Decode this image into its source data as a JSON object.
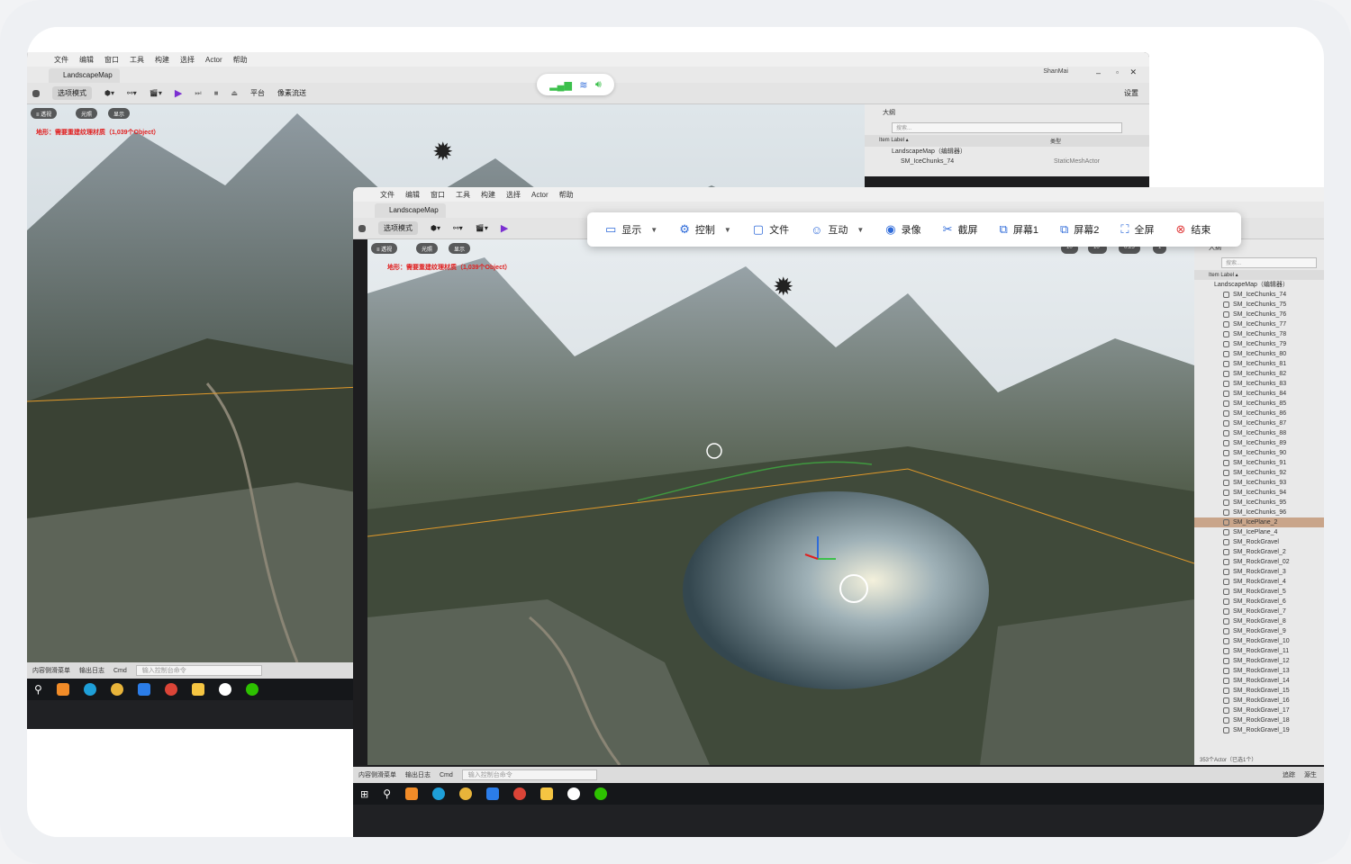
{
  "menu": [
    "文件",
    "编辑",
    "窗口",
    "工具",
    "构建",
    "选择",
    "Actor",
    "帮助"
  ],
  "back_window": {
    "tab_title": "LandscapeMap",
    "user": "ShanMai",
    "mode_label": "选项模式",
    "platform_label": "平台",
    "pixel_label": "像素流送",
    "settings_label": "设置",
    "viewport_buttons": [
      "透视",
      "光照",
      "显示"
    ],
    "warning_text": "地形：需要重建纹理材质（1,039个Object）",
    "outliner_title": "大纲",
    "search_placeholder": "搜索...",
    "col_item_label": "Item Label ▴",
    "col_type": "类型",
    "tree_root": "LandscapeMap（编辑器）",
    "first_item": "SM_IceChunks_74",
    "first_item_type": "StaticMeshActor",
    "status_content": "内容侧滑菜单",
    "status_log": "输出日志",
    "status_cmd": "Cmd",
    "cmd_placeholder": "输入控制台命令"
  },
  "front_window": {
    "tab_title": "LandscapeMap",
    "mode_label": "选项模式",
    "viewport_buttons": [
      "透视",
      "光照",
      "显示"
    ],
    "warning_text": "地形：需要重建纹理材质（1,039个Object）",
    "viewport_values": [
      "10",
      "10°",
      "0.25",
      "1"
    ],
    "outliner_title": "大纲",
    "search_placeholder": "搜索...",
    "col_item_label": "Item Label ▴",
    "tree_root": "LandscapeMap（编辑器）",
    "items": [
      "SM_IceChunks_74",
      "SM_IceChunks_75",
      "SM_IceChunks_76",
      "SM_IceChunks_77",
      "SM_IceChunks_78",
      "SM_IceChunks_79",
      "SM_IceChunks_80",
      "SM_IceChunks_81",
      "SM_IceChunks_82",
      "SM_IceChunks_83",
      "SM_IceChunks_84",
      "SM_IceChunks_85",
      "SM_IceChunks_86",
      "SM_IceChunks_87",
      "SM_IceChunks_88",
      "SM_IceChunks_89",
      "SM_IceChunks_90",
      "SM_IceChunks_91",
      "SM_IceChunks_92",
      "SM_IceChunks_93",
      "SM_IceChunks_94",
      "SM_IceChunks_95",
      "SM_IceChunks_96",
      "SM_IcePlane_2",
      "SM_IcePlane_4",
      "SM_RockGravel",
      "SM_RockGravel_2",
      "SM_RockGravel_02",
      "SM_RockGravel_3",
      "SM_RockGravel_4",
      "SM_RockGravel_5",
      "SM_RockGravel_6",
      "SM_RockGravel_7",
      "SM_RockGravel_8",
      "SM_RockGravel_9",
      "SM_RockGravel_10",
      "SM_RockGravel_11",
      "SM_RockGravel_12",
      "SM_RockGravel_13",
      "SM_RockGravel_14",
      "SM_RockGravel_15",
      "SM_RockGravel_16",
      "SM_RockGravel_17",
      "SM_RockGravel_18",
      "SM_RockGravel_19"
    ],
    "selected_item": "SM_IcePlane_2",
    "actor_count": "353个Actor（已选1个）",
    "status_content": "内容侧滑菜单",
    "status_log": "输出日志",
    "status_cmd": "Cmd",
    "cmd_placeholder": "输入控制台命令",
    "status_right_1": "追踪",
    "status_right_2": "源生"
  },
  "control_bar": {
    "items": [
      {
        "label": "显示",
        "icon": "monitor-icon",
        "dropdown": true
      },
      {
        "label": "控制",
        "icon": "control-icon",
        "dropdown": true
      },
      {
        "label": "文件",
        "icon": "folder-icon",
        "dropdown": false
      },
      {
        "label": "互动",
        "icon": "interact-icon",
        "dropdown": true
      },
      {
        "label": "录像",
        "icon": "record-icon",
        "dropdown": false
      },
      {
        "label": "截屏",
        "icon": "scissors-icon",
        "dropdown": false
      },
      {
        "label": "屏幕1",
        "icon": "screen-icon",
        "dropdown": false
      },
      {
        "label": "屏幕2",
        "icon": "screen-icon",
        "dropdown": false
      },
      {
        "label": "全屏",
        "icon": "fullscreen-icon",
        "dropdown": false
      },
      {
        "label": "结束",
        "icon": "close-circle-icon",
        "dropdown": false
      }
    ],
    "accent": "#2f6bd9",
    "end_color": "#e03a3a"
  },
  "colors": {
    "signal_green": "#3cc04c",
    "accent_blue": "#2f6bd9",
    "selection": "#c9a58a",
    "warning_red": "#e02020"
  }
}
